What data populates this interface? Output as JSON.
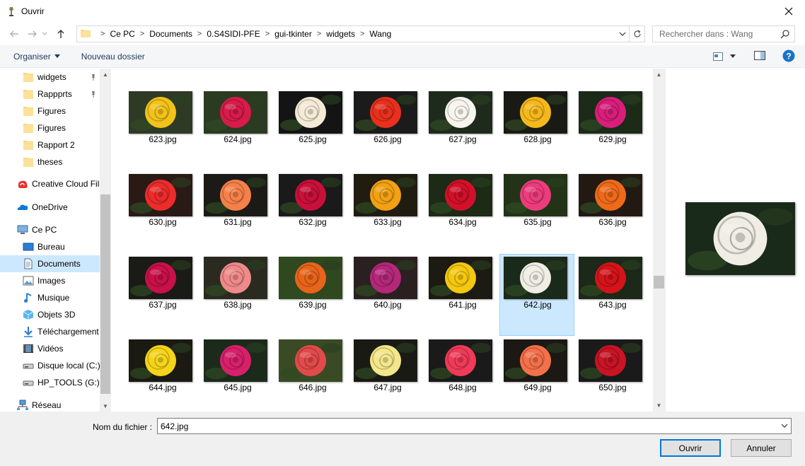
{
  "window": {
    "title": "Ouvrir"
  },
  "address": {
    "breadcrumbs": [
      "Ce PC",
      "Documents",
      "0.S4SIDI-PFE",
      "gui-tkinter",
      "widgets",
      "Wang"
    ]
  },
  "search": {
    "placeholder": "Rechercher dans : Wang"
  },
  "toolbar": {
    "organize_label": "Organiser",
    "new_folder_label": "Nouveau dossier"
  },
  "sidebar": {
    "items": [
      {
        "label": "widgets",
        "icon": "folder-icon",
        "pinned": true
      },
      {
        "label": "Rappprts",
        "icon": "folder-icon",
        "pinned": true
      },
      {
        "label": "Figures",
        "icon": "folder-icon"
      },
      {
        "label": "Figures",
        "icon": "folder-icon"
      },
      {
        "label": "Rapport 2",
        "icon": "folder-icon"
      },
      {
        "label": "theses",
        "icon": "folder-icon"
      },
      {
        "label": "Creative Cloud Fil",
        "icon": "creative-cloud-icon"
      },
      {
        "label": "OneDrive",
        "icon": "onedrive-icon"
      },
      {
        "label": "Ce PC",
        "icon": "computer-icon"
      },
      {
        "label": "Bureau",
        "icon": "desktop-icon"
      },
      {
        "label": "Documents",
        "icon": "documents-icon",
        "selected": true
      },
      {
        "label": "Images",
        "icon": "images-icon"
      },
      {
        "label": "Musique",
        "icon": "music-icon"
      },
      {
        "label": "Objets 3D",
        "icon": "3d-objects-icon"
      },
      {
        "label": "Téléchargement",
        "icon": "download-icon"
      },
      {
        "label": "Vidéos",
        "icon": "videos-icon"
      },
      {
        "label": "Disque local (C:)",
        "icon": "drive-icon"
      },
      {
        "label": "HP_TOOLS (G:)",
        "icon": "drive-icon"
      },
      {
        "label": "Réseau",
        "icon": "network-icon"
      }
    ]
  },
  "files": [
    {
      "name": "623.jpg",
      "color": "#f2c21a",
      "bg": "#2f3a26"
    },
    {
      "name": "624.jpg",
      "color": "#d81b4a",
      "bg": "#2b3b22"
    },
    {
      "name": "625.jpg",
      "color": "#f4ead6",
      "bg": "#141414"
    },
    {
      "name": "626.jpg",
      "color": "#e8301d",
      "bg": "#1b1b1b"
    },
    {
      "name": "627.jpg",
      "color": "#f7f5ee",
      "bg": "#1e2a1c"
    },
    {
      "name": "628.jpg",
      "color": "#f5b81c",
      "bg": "#1a1a14"
    },
    {
      "name": "629.jpg",
      "color": "#d81e7a",
      "bg": "#1c2a18"
    },
    {
      "name": "630.jpg",
      "color": "#ec2b2b",
      "bg": "#2a1a16"
    },
    {
      "name": "631.jpg",
      "color": "#f6804a",
      "bg": "#1c1a16"
    },
    {
      "name": "632.jpg",
      "color": "#c8103a",
      "bg": "#1a1a1a"
    },
    {
      "name": "633.jpg",
      "color": "#f2a014",
      "bg": "#201c10"
    },
    {
      "name": "634.jpg",
      "color": "#d2102a",
      "bg": "#1c2a16"
    },
    {
      "name": "635.jpg",
      "color": "#ec3c7c",
      "bg": "#223318"
    },
    {
      "name": "636.jpg",
      "color": "#ee6a1a",
      "bg": "#221a12"
    },
    {
      "name": "637.jpg",
      "color": "#c8104a",
      "bg": "#1a1a16"
    },
    {
      "name": "638.jpg",
      "color": "#f08a8a",
      "bg": "#2a2a20"
    },
    {
      "name": "639.jpg",
      "color": "#e8641a",
      "bg": "#304820"
    },
    {
      "name": "640.jpg",
      "color": "#b4287a",
      "bg": "#2a2020"
    },
    {
      "name": "641.jpg",
      "color": "#f4c810",
      "bg": "#1c1a12"
    },
    {
      "name": "642.jpg",
      "color": "#f0eee4",
      "bg": "#1a2a1a"
    },
    {
      "name": "643.jpg",
      "color": "#d4141a",
      "bg": "#1c2818"
    },
    {
      "name": "644.jpg",
      "color": "#f6d41a",
      "bg": "#1a1a12"
    },
    {
      "name": "645.jpg",
      "color": "#d8206a",
      "bg": "#1c2a1c"
    },
    {
      "name": "646.jpg",
      "color": "#e24a4a",
      "bg": "#3a4a24"
    },
    {
      "name": "647.jpg",
      "color": "#f4e68a",
      "bg": "#1a1a14"
    },
    {
      "name": "648.jpg",
      "color": "#f03a58",
      "bg": "#1a1a1a"
    },
    {
      "name": "649.jpg",
      "color": "#f4704a",
      "bg": "#1c1814"
    },
    {
      "name": "650.jpg",
      "color": "#c81424",
      "bg": "#1a1a1a"
    }
  ],
  "selected_file": "642.jpg",
  "preview": {
    "color": "#f0eee4",
    "bg": "#1a2a1a"
  },
  "footer": {
    "filename_label": "Nom du fichier :",
    "filename_value": "642.jpg",
    "open_label": "Ouvrir",
    "cancel_label": "Annuler"
  }
}
